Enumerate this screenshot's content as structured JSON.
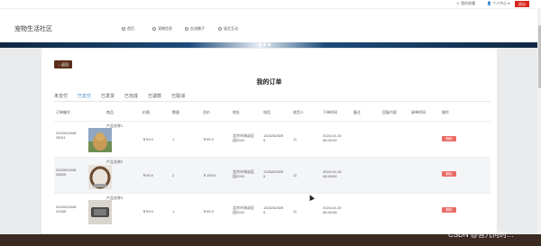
{
  "topbar": {
    "links": [
      "我的收藏",
      "个人中心"
    ],
    "logout": "退出"
  },
  "header": {
    "logo": "宠物生活社区",
    "nav": [
      "首页",
      "宠物信息",
      "交流圈子",
      "留言互动"
    ]
  },
  "page": {
    "back": "←返回",
    "title": "我的订单",
    "tabs": [
      "未支付",
      "已支付",
      "已发货",
      "已完成",
      "已退款",
      "已取消"
    ],
    "active_tab": "已支付"
  },
  "table": {
    "headers": [
      "订单编号",
      "商品",
      "价格",
      "数量",
      "总价",
      "地址",
      "电话",
      "收货人",
      "下单时间",
      "备注",
      "回复内容",
      "录单时间",
      "操作"
    ],
    "rows": [
      {
        "id_1": "2024041548",
        "id_2": "25011",
        "product": "产品名称1",
        "price": "￥99.9",
        "qty": "1",
        "total": "￥99.9",
        "addr_1": "北京市海淀区",
        "addr_2": "园2015",
        "phone_1": "1325252525",
        "phone_2": "5",
        "receiver": "11",
        "time_1": "2024-04-15",
        "time_2": "08:49:52",
        "action": "删除"
      },
      {
        "id_1": "2024041548",
        "id_2": "25609",
        "product": "产品名称2",
        "price": "￥99.9",
        "qty": "2",
        "total": "￥199.8",
        "addr_1": "北京市海淀区",
        "addr_2": "园2015",
        "phone_1": "1325252525",
        "phone_2": "5",
        "receiver": "11",
        "time_1": "2024-04-15",
        "time_2": "08:49:52",
        "action": "删除"
      },
      {
        "id_1": "2024041548",
        "id_2": "29285",
        "product": "产品名称3",
        "price": "￥99.9",
        "qty": "1",
        "total": "￥99.9",
        "addr_1": "北京市海淀区",
        "addr_2": "园2015",
        "phone_1": "1325252525",
        "phone_2": "5",
        "receiver": "11",
        "time_1": "2024-04-15",
        "time_2": "08:49:56",
        "action": "删除"
      }
    ]
  },
  "watermark": "CSDN @曾几何时…",
  "colors": {
    "accent": "#d9261c",
    "back_button": "#5b2f1c",
    "active_tab": "#3a87c8",
    "delete_button": "#ea6b66"
  }
}
